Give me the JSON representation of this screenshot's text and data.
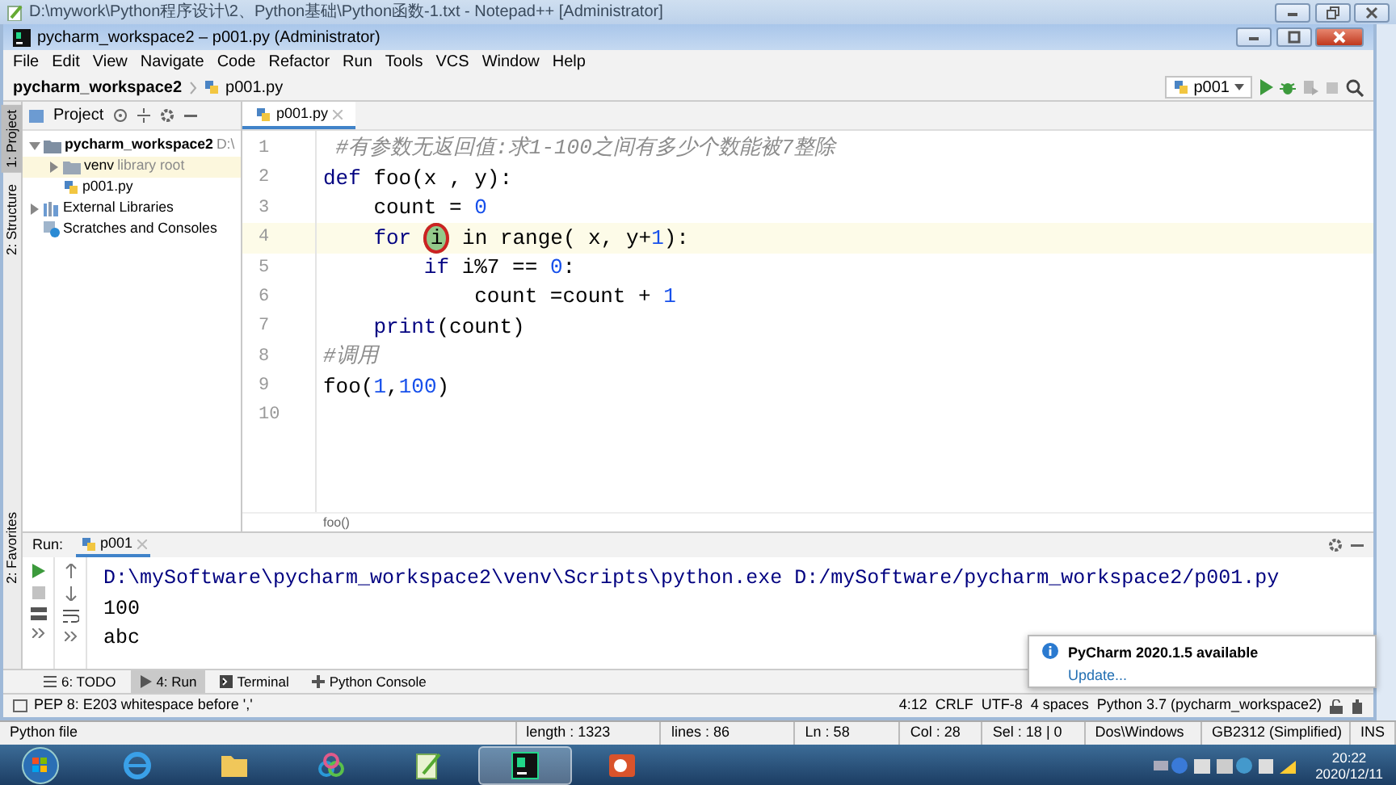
{
  "notepad_window": {
    "title": "D:\\mywork\\Python程序设计\\2、Python基础\\Python函数-1.txt - Notepad++ [Administrator]"
  },
  "window": {
    "title": "pycharm_workspace2 – p001.py (Administrator)"
  },
  "menu": [
    "File",
    "Edit",
    "View",
    "Navigate",
    "Code",
    "Refactor",
    "Run",
    "Tools",
    "VCS",
    "Window",
    "Help"
  ],
  "breadcrumb": [
    "pycharm_workspace2",
    "p001.py"
  ],
  "run_config": {
    "label": "p001"
  },
  "left_stripe": [
    {
      "label": "1: Project",
      "selected": true
    },
    {
      "label": "2: Structure",
      "selected": false
    }
  ],
  "favorites_stripe": {
    "label": "2: Favorites"
  },
  "project_panel": {
    "title": "Project",
    "tree": [
      {
        "label": "pycharm_workspace2",
        "hint": "D:\\",
        "kind": "project-root",
        "expanded": true,
        "selected": false,
        "children": [
          {
            "label": "venv",
            "hint": "library root",
            "kind": "folder",
            "expanded": false,
            "selected": true
          },
          {
            "label": "p001.py",
            "kind": "python-file",
            "selected": false
          }
        ]
      },
      {
        "label": "External Libraries",
        "kind": "libraries",
        "expanded": false,
        "selected": false
      },
      {
        "label": "Scratches and Consoles",
        "kind": "scratches",
        "selected": false
      }
    ]
  },
  "editor": {
    "tabs": [
      {
        "label": "p001.py",
        "selected": true
      }
    ],
    "lines": [
      {
        "number": "1",
        "caret": false,
        "segments": [
          {
            "kind": "comment",
            "text": " #有参数无返回值:求1-100之间有多少个数能被7整除"
          }
        ]
      },
      {
        "number": "2",
        "caret": false,
        "segments": [
          {
            "kind": "keyword",
            "text": "def"
          },
          {
            "kind": "text",
            "text": " foo(x , y):"
          }
        ]
      },
      {
        "number": "3",
        "caret": false,
        "segments": [
          {
            "kind": "text",
            "text": "    count = "
          },
          {
            "kind": "number",
            "text": "0"
          }
        ]
      },
      {
        "number": "4",
        "caret": true,
        "segments": [
          {
            "kind": "keyword",
            "text": "    for "
          },
          {
            "kind": "pointer",
            "text": "i"
          },
          {
            "kind": "text",
            "text": " in range( x, y+"
          },
          {
            "kind": "number",
            "text": "1"
          },
          {
            "kind": "text",
            "text": "):"
          }
        ]
      },
      {
        "number": "5",
        "caret": false,
        "segments": [
          {
            "kind": "keyword",
            "text": "        if"
          },
          {
            "kind": "text",
            "text": " i%7 == "
          },
          {
            "kind": "number",
            "text": "0"
          },
          {
            "kind": "text",
            "text": ":"
          }
        ]
      },
      {
        "number": "6",
        "caret": false,
        "segments": [
          {
            "kind": "text",
            "text": "            count =count + "
          },
          {
            "kind": "number",
            "text": "1"
          }
        ]
      },
      {
        "number": "7",
        "caret": false,
        "segments": [
          {
            "kind": "builtin",
            "text": "    print"
          },
          {
            "kind": "text",
            "text": "(count)"
          }
        ]
      },
      {
        "number": "8",
        "caret": false,
        "segments": [
          {
            "kind": "comment",
            "text": "#调用"
          }
        ]
      },
      {
        "number": "9",
        "caret": false,
        "segments": [
          {
            "kind": "text",
            "text": "foo("
          },
          {
            "kind": "number",
            "text": "1"
          },
          {
            "kind": "text",
            "text": ","
          },
          {
            "kind": "number",
            "text": "100"
          },
          {
            "kind": "text",
            "text": ")"
          }
        ]
      },
      {
        "number": "10",
        "caret": false
      }
    ],
    "breadcrumb": "foo()"
  },
  "run_panel": {
    "label": "Run:",
    "tab": "p001",
    "output": [
      "D:\\mySoftware\\pycharm_workspace2\\venv\\Scripts\\python.exe D:/mySoftware/pycharm_workspace2/p001.py",
      "100",
      "abc"
    ]
  },
  "tool_tabs": [
    {
      "label": "6: TODO",
      "kind": "todo",
      "selected": false
    },
    {
      "label": "4: Run",
      "kind": "run",
      "selected": true
    },
    {
      "label": "Terminal",
      "kind": "terminal",
      "selected": false
    },
    {
      "label": "Python Console",
      "kind": "console",
      "selected": false
    }
  ],
  "notification": {
    "title": "PyCharm 2020.1.5 available",
    "link": "Update..."
  },
  "status_bar": {
    "message": "PEP 8: E203 whitespace before ','",
    "items": [
      "4:12",
      "CRLF",
      "UTF-8",
      "4 spaces",
      "Python 3.7 (pycharm_workspace2)"
    ]
  },
  "notepad_status": [
    "Python file",
    "length : 1323",
    "lines : 86",
    "Ln : 58",
    "Col : 28",
    "Sel : 18 | 0",
    "Dos\\Windows",
    "GB2312 (Simplified)",
    "INS"
  ],
  "taskbar": {
    "apps": [
      {
        "kind": "browser",
        "selected": false
      },
      {
        "kind": "folder",
        "selected": false
      },
      {
        "kind": "cloud",
        "selected": false
      },
      {
        "kind": "notepad",
        "selected": false
      },
      {
        "kind": "pycharm",
        "selected": true
      },
      {
        "kind": "slides",
        "selected": false
      }
    ],
    "time": "20:22",
    "date": "2020/12/11"
  }
}
